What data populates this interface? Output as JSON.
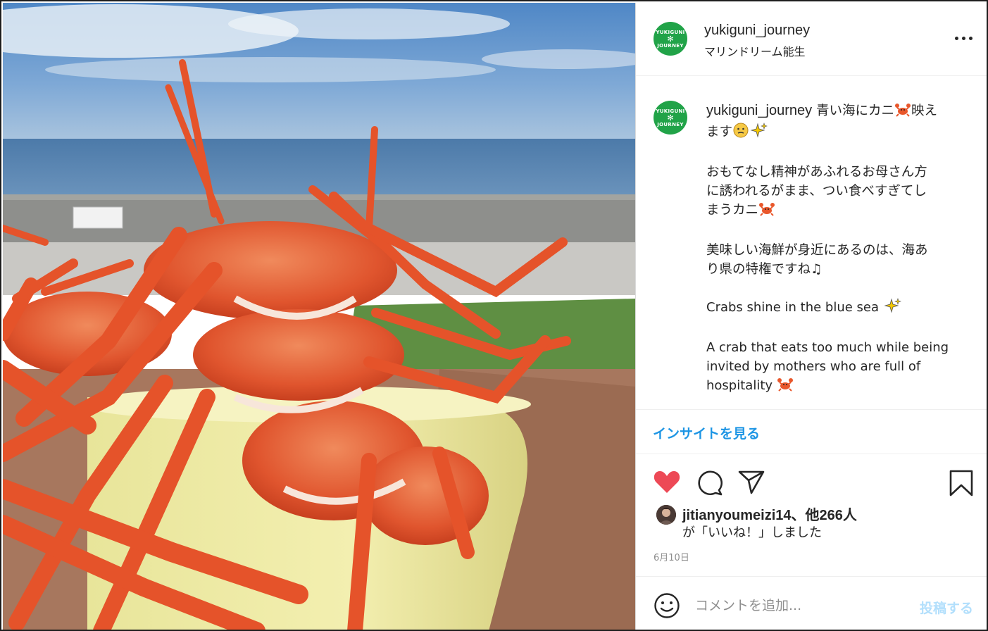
{
  "post": {
    "username": "yukiguni_journey",
    "location": "マリンドリーム能生",
    "avatar_text_top": "YUKIGUNI",
    "avatar_text_mid": "✻",
    "avatar_text_bottom": "JOURNEY",
    "brand_color": "#21a348"
  },
  "caption": {
    "username": "yukiguni_journey",
    "line1_a": "青い海にカニ",
    "line1_b": "映え",
    "line2": "ます",
    "para2_l1": "おもてなし精神があふれるお母さん方",
    "para2_l2": "に誘われるがまま、つい食べすぎてし",
    "para2_l3": "まうカニ",
    "para3_l1": "美味しい海鮮が身近にあるのは、海あ",
    "para3_l2": "り県の特権ですね♫",
    "en1": "Crabs shine in the blue sea",
    "en2_l1": "A crab that eats too much while being",
    "en2_l2": "invited by mothers who are full of",
    "en2_l3": "hospitality"
  },
  "insights": {
    "label": "インサイトを見る",
    "color": "#1d95e4"
  },
  "actions": {
    "liked": true,
    "like_color": "#ed4956",
    "icons": [
      "heart-icon",
      "comment-icon",
      "share-icon",
      "bookmark-icon"
    ]
  },
  "likes": {
    "line1": "jitianyoumeizi14、他266人",
    "line2": "が「いいね！」しました"
  },
  "date": "6月10日",
  "comment": {
    "placeholder": "コメントを追加...",
    "post_label": "投稿する"
  }
}
